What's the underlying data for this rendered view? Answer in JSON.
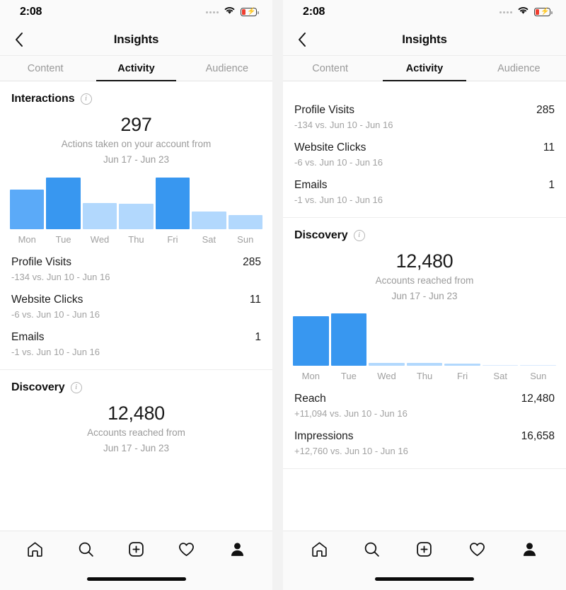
{
  "status_bar": {
    "time": "2:08",
    "cellular_icon": "signal-dots-icon",
    "wifi_icon": "wifi-icon",
    "battery_icon": "battery-charging-icon",
    "battery_color": "#f03e2f"
  },
  "nav": {
    "back_icon": "chevron-left-icon",
    "title": "Insights"
  },
  "tabs": [
    {
      "label": "Content",
      "active": false
    },
    {
      "label": "Activity",
      "active": true
    },
    {
      "label": "Audience",
      "active": false
    }
  ],
  "theme": {
    "accent_blue": "#3897f0",
    "mid_blue": "#5baaf8",
    "light_blue": "#b2d8fd",
    "text_primary": "#1b1b1b",
    "text_muted": "#a0a0a0"
  },
  "left_screen": {
    "interactions": {
      "title": "Interactions",
      "info_icon": "info-icon",
      "total": "297",
      "subtitle_line1": "Actions taken on your account from",
      "subtitle_line2": "Jun 17 - Jun 23"
    },
    "stats": [
      {
        "label": "Profile Visits",
        "value": "285",
        "delta": "-134 vs. Jun 10 - Jun 16"
      },
      {
        "label": "Website Clicks",
        "value": "11",
        "delta": "-6 vs. Jun 10 - Jun 16"
      },
      {
        "label": "Emails",
        "value": "1",
        "delta": "-1 vs. Jun 10 - Jun 16"
      }
    ],
    "discovery": {
      "title": "Discovery",
      "info_icon": "info-icon",
      "total": "12,480",
      "subtitle_line1": "Accounts reached from",
      "subtitle_line2": "Jun 17 - Jun 23"
    }
  },
  "right_screen": {
    "stats": [
      {
        "label": "Profile Visits",
        "value": "285",
        "delta": "-134 vs. Jun 10 - Jun 16"
      },
      {
        "label": "Website Clicks",
        "value": "11",
        "delta": "-6 vs. Jun 10 - Jun 16"
      },
      {
        "label": "Emails",
        "value": "1",
        "delta": "-1 vs. Jun 10 - Jun 16"
      }
    ],
    "discovery": {
      "title": "Discovery",
      "info_icon": "info-icon",
      "total": "12,480",
      "subtitle_line1": "Accounts reached from",
      "subtitle_line2": "Jun 17 - Jun 23"
    },
    "stats_bottom": [
      {
        "label": "Reach",
        "value": "12,480",
        "delta": "+11,094 vs. Jun 10 - Jun 16"
      },
      {
        "label": "Impressions",
        "value": "16,658",
        "delta": "+12,760 vs. Jun 10 - Jun 16"
      }
    ]
  },
  "bottom_nav": [
    {
      "icon": "home-icon",
      "label": "Home"
    },
    {
      "icon": "search-icon",
      "label": "Search"
    },
    {
      "icon": "add-post-icon",
      "label": "New Post"
    },
    {
      "icon": "heart-icon",
      "label": "Activity"
    },
    {
      "icon": "profile-icon",
      "label": "Profile"
    }
  ],
  "chart_data": [
    {
      "type": "bar",
      "title": "Interactions",
      "subtitle": "Actions taken on your account from Jun 17 - Jun 23",
      "total": 297,
      "categories": [
        "Mon",
        "Tue",
        "Wed",
        "Thu",
        "Fri",
        "Sat",
        "Sun"
      ],
      "values": [
        56,
        73,
        37,
        36,
        73,
        25,
        20
      ],
      "colors": [
        "#5baaf8",
        "#3897f0",
        "#b2d8fd",
        "#b2d8fd",
        "#3897f0",
        "#b2d8fd",
        "#b2d8fd"
      ],
      "xlabel": "",
      "ylabel": "",
      "ylim": [
        0,
        75
      ],
      "grid": false,
      "legend": "none"
    },
    {
      "type": "bar",
      "title": "Discovery",
      "subtitle": "Accounts reached from Jun 17 - Jun 23",
      "total": 12480,
      "categories": [
        "Mon",
        "Tue",
        "Wed",
        "Thu",
        "Fri",
        "Sat",
        "Sun"
      ],
      "values": [
        70,
        74,
        4,
        4,
        3,
        1.5,
        1.5
      ],
      "colors": [
        "#3897f0",
        "#3897f0",
        "#b2d8fd",
        "#b2d8fd",
        "#b2d8fd",
        "#d9eafe",
        "#d9eafe"
      ],
      "xlabel": "",
      "ylabel": "",
      "ylim": [
        0,
        75
      ],
      "grid": false,
      "legend": "none"
    }
  ]
}
